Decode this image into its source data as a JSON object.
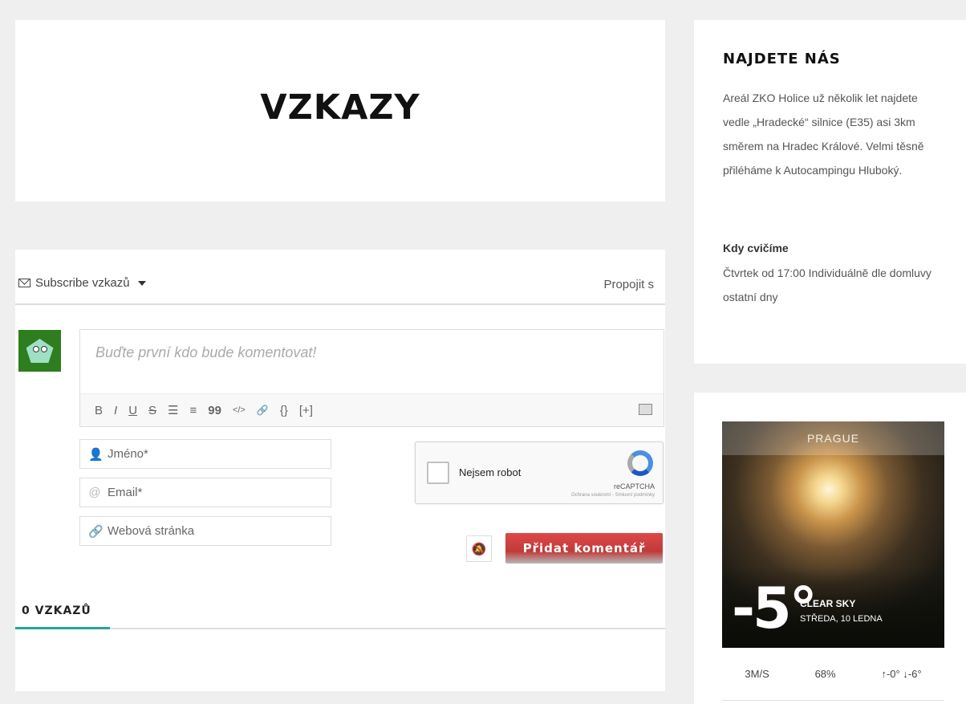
{
  "page": {
    "title": "VZKAZY"
  },
  "comments": {
    "subscribe_label": "Subscribe vzkazů",
    "connect_label": "Propojit s",
    "placeholder": "Buďte první kdo bude komentovat!",
    "toolbar": [
      "B",
      "I",
      "U",
      "S",
      "☰",
      "≡",
      "99",
      "</>",
      "🔗",
      "{}",
      "[+]"
    ],
    "fields": {
      "name": "Jméno*",
      "email": "Email*",
      "website": "Webová stránka"
    },
    "captcha": {
      "label": "Nejsem robot",
      "brand": "reCAPTCHA",
      "terms": "Ochrana soukromí - Smluvní podmínky"
    },
    "submit_label": "Přidat komentář",
    "count_label": "0 VZKAZŮ"
  },
  "sidebar": {
    "find": {
      "heading": "NAJDETE NÁS",
      "text": "Areál ZKO Holice už několik let najdete vedle „Hradecké“ silnice (E35) asi 3km směrem na Hradec Králové. Velmi těsně přiléháme k Autocampingu Hluboký.",
      "when_title": "Kdy cvičíme",
      "when_text": "Čtvrtek od 17:00 Individuálně dle domluvy ostatní dny"
    },
    "weather": {
      "city": "PRAGUE",
      "temp": "-5°",
      "condition": "CLEAR SKY",
      "date": "STŘEDA, 10 LEDNA",
      "wind": "3M/S",
      "humidity": "68%",
      "range": "↑-0° ↓-6°"
    }
  },
  "colors": {
    "accent": "#26a69a",
    "submit": "#d84545",
    "avatar_bg": "#2e7d1f"
  },
  "icons": {
    "subscribe": "envelope-icon",
    "name": "user-icon",
    "email": "at-icon",
    "website": "link-icon",
    "mute": "bell-off-icon"
  }
}
